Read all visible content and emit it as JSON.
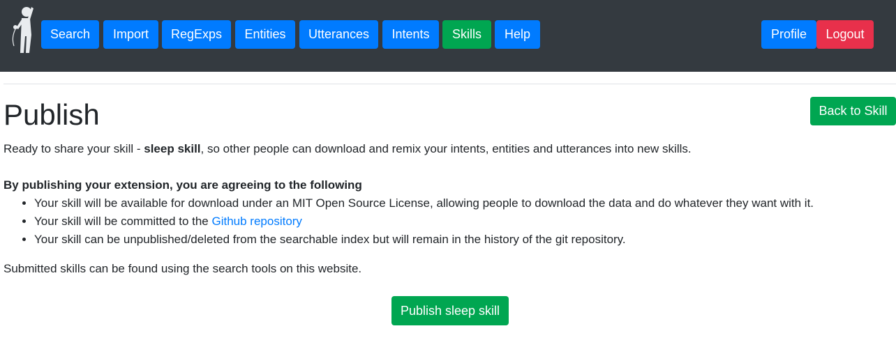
{
  "navbar": {
    "logo_icon": "singer-with-microphone-icon",
    "items": [
      {
        "label": "Search",
        "color": "#007bff"
      },
      {
        "label": "Import",
        "color": "#007bff"
      },
      {
        "label": "RegExps",
        "color": "#007bff"
      },
      {
        "label": "Entities",
        "color": "#007bff"
      },
      {
        "label": "Utterances",
        "color": "#007bff"
      },
      {
        "label": "Intents",
        "color": "#007bff"
      },
      {
        "label": "Skills",
        "color": "#00a651",
        "active": true
      },
      {
        "label": "Help",
        "color": "#007bff"
      }
    ],
    "profile_label": "Profile",
    "logout_label": "Logout"
  },
  "page": {
    "title": "Publish",
    "back_label": "Back to Skill",
    "intro_prefix": "Ready to share your skill - ",
    "skill_name": "sleep skill",
    "intro_suffix": ", so other people can download and remix your intents, entities and utterances into new skills.",
    "agree_heading": "By publishing your extension, you are agreeing to the following",
    "terms": {
      "item1": "Your skill will be available for download under an MIT Open Source License, allowing people to download the data and do whatever they want with it.",
      "item2_prefix": "Your skill will be committed to the ",
      "item2_link": "Github repository",
      "item3": "Your skill can be unpublished/deleted from the searchable index but will remain in the history of the git repository."
    },
    "submitted_note": "Submitted skills can be found using the search tools on this website.",
    "publish_label": "Publish sleep skill"
  },
  "colors": {
    "navbar_bg": "#343a40",
    "primary": "#007bff",
    "success": "#00a651",
    "danger": "#e8304b"
  }
}
